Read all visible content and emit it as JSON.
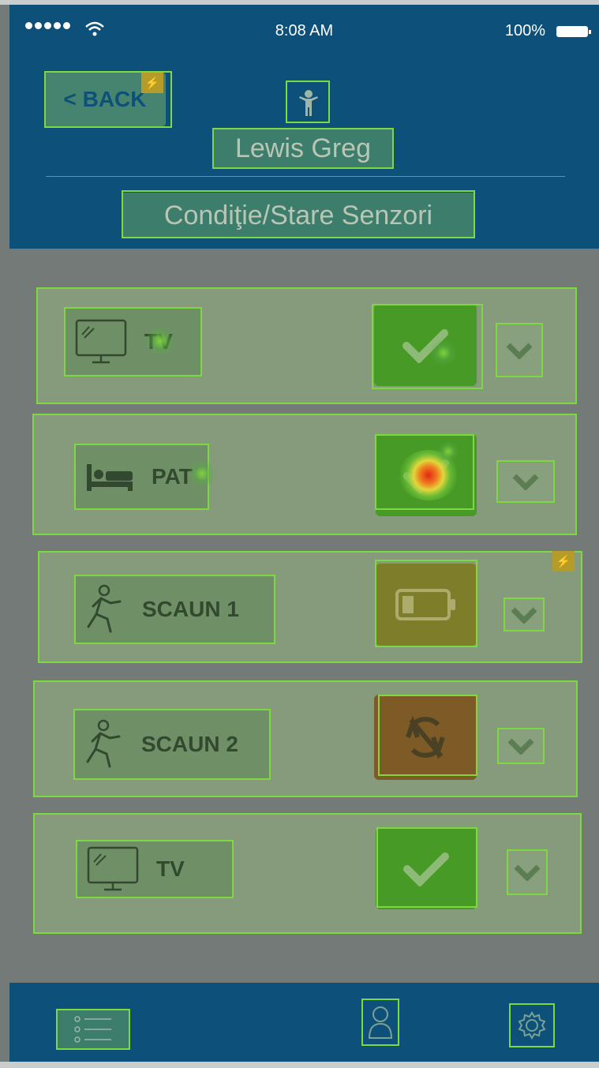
{
  "status_bar": {
    "time": "8:08 AM",
    "battery": "100%"
  },
  "header": {
    "back_label": "< BACK",
    "patient_name": "Lewis Greg",
    "section_title": "Condiţie/Stare Senzori"
  },
  "devices": [
    {
      "label": "TV",
      "icon": "tv-icon",
      "status": "ok"
    },
    {
      "label": "PAT",
      "icon": "bed-icon",
      "status": "ok"
    },
    {
      "label": "SCAUN 1",
      "icon": "running-person-icon",
      "status": "low-battery"
    },
    {
      "label": "SCAUN 2",
      "icon": "running-person-icon",
      "status": "sync-off"
    },
    {
      "label": "TV",
      "icon": "tv-icon",
      "status": "ok"
    }
  ],
  "tabbar": {
    "items": [
      "list-icon",
      "profile-icon",
      "settings-icon"
    ]
  },
  "colors": {
    "header": "#0d5079",
    "ok": "#479a26",
    "battery": "#7e7d2a",
    "error": "#7d5a26",
    "outline": "#7ed940"
  }
}
